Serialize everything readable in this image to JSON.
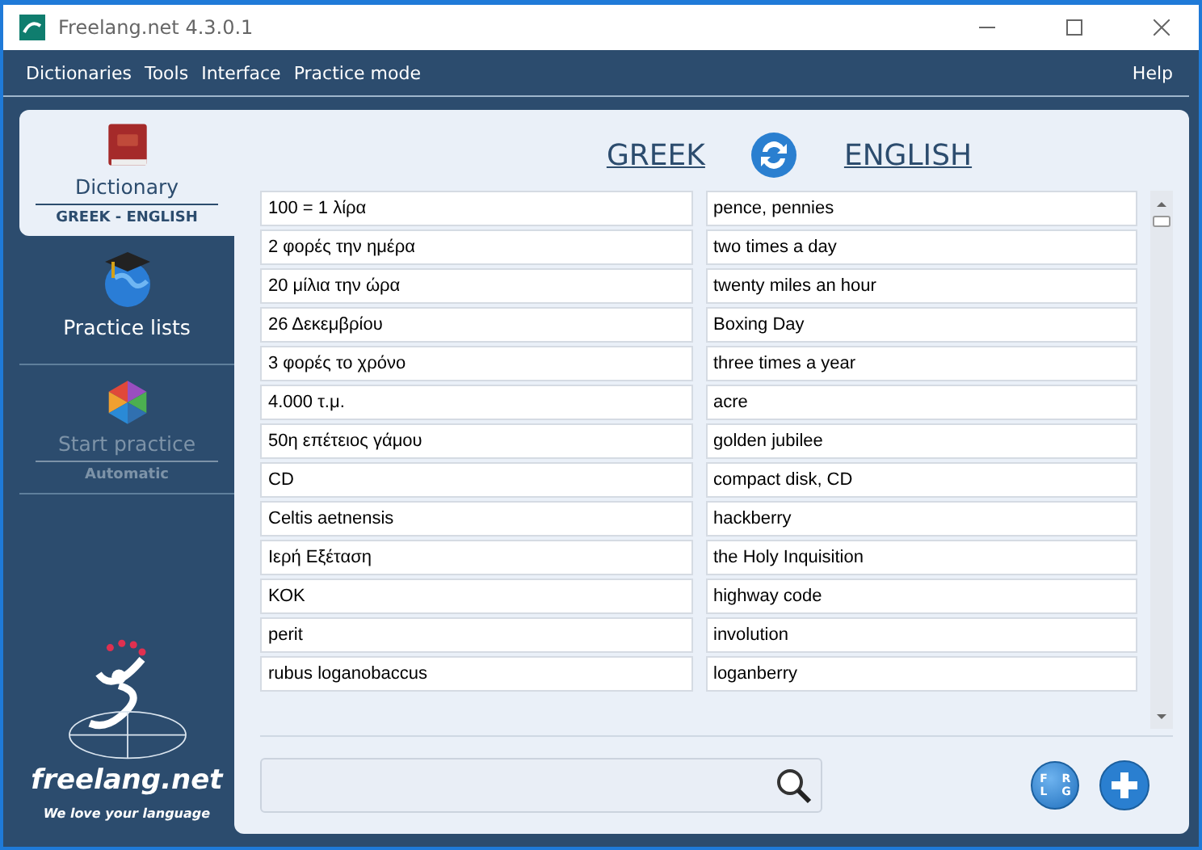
{
  "window": {
    "title": "Freelang.net 4.3.0.1"
  },
  "menu": [
    "Dictionaries",
    "Tools",
    "Interface",
    "Practice mode"
  ],
  "help_menu": "Help",
  "sidebar": {
    "items": [
      {
        "kind": "dictionary",
        "label": "Dictionary",
        "subtitle": "GREEK - ENGLISH",
        "selected": true,
        "disabled": false
      },
      {
        "kind": "lists",
        "label": "Practice lists",
        "selected": false,
        "disabled": false
      },
      {
        "kind": "practice",
        "label": "Start practice",
        "subtitle": "Automatic",
        "selected": false,
        "disabled": true
      }
    ],
    "logo_text": "freelang.net",
    "tagline": "We love your language"
  },
  "languages": {
    "source": "GREEK",
    "target": "ENGLISH"
  },
  "entries": [
    {
      "greek": "100 = 1 λίρα",
      "english": "pence, pennies"
    },
    {
      "greek": "2 φορές την ημέρα",
      "english": "two times a day"
    },
    {
      "greek": "20 μίλια την ώρα",
      "english": "twenty miles an hour"
    },
    {
      "greek": "26 Δεκεμβρίου",
      "english": "Boxing Day"
    },
    {
      "greek": "3 φορές το χρόνο",
      "english": "three times a year"
    },
    {
      "greek": "4.000 τ.μ.",
      "english": "acre"
    },
    {
      "greek": "50η επέτειος γάμου",
      "english": "golden jubilee"
    },
    {
      "greek": "CD",
      "english": "compact disk, CD"
    },
    {
      "greek": "Celtis aetnensis",
      "english": "hackberry"
    },
    {
      "greek": "Ιερή Εξέταση",
      "english": "the Holy Inquisition"
    },
    {
      "greek": "ΚΟΚ",
      "english": "highway code"
    },
    {
      "greek": "perit",
      "english": "involution"
    },
    {
      "greek": "rubus loganobaccus",
      "english": "loganberry"
    }
  ],
  "keyboard_button": [
    "F",
    "R",
    "L",
    "G"
  ]
}
